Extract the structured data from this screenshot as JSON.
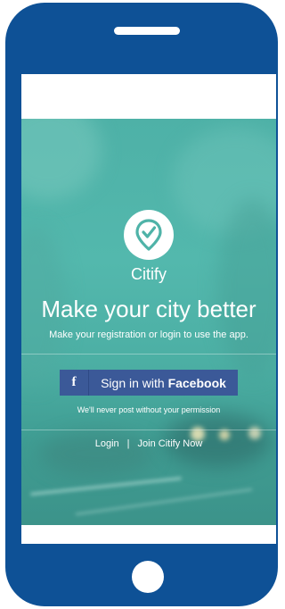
{
  "app": {
    "name": "Citify",
    "logo_icon": "location-pin-check-icon"
  },
  "hero": {
    "headline": "Make your city better",
    "subline": "Make your registration or login to use the app."
  },
  "facebook_button": {
    "icon": "f",
    "label_prefix": "Sign in with",
    "label_brand": "Facebook"
  },
  "privacy_note": "We'll never post without your permission",
  "links": {
    "login": "Login",
    "separator": "|",
    "join": "Join Citify Now"
  },
  "colors": {
    "phone_frame": "#0e5196",
    "hero_teal": "#4eb1a7",
    "facebook_blue": "#3b5998"
  }
}
